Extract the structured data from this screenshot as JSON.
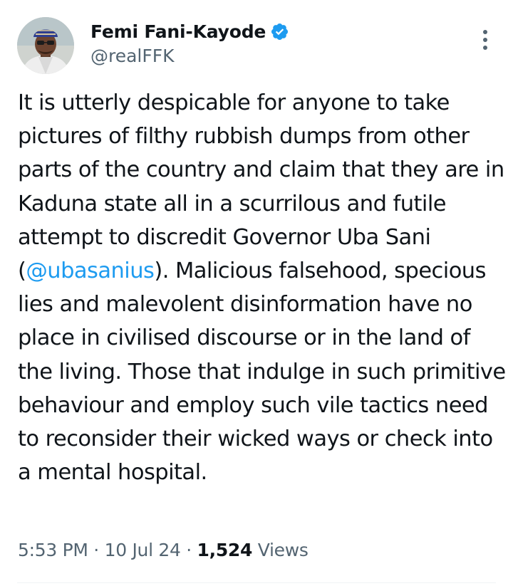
{
  "author": {
    "display_name": "Femi Fani-Kayode",
    "handle": "@realFFK",
    "verified": true,
    "avatar_icon": "profile-photo"
  },
  "tweet": {
    "text_part1": "It is utterly despicable for anyone to take pictures of filthy rubbish dumps from other parts of the country and claim that they are in Kaduna state all in a scurrilous and futile attempt to discredit Governor Uba Sani (",
    "mention": "@ubasanius",
    "text_part2": "). Malicious falsehood, specious lies and malevolent disinformation have no place in civilised discourse or in the land of the living. Those that indulge in such primitive behaviour and employ such vile tactics need to reconsider their wicked ways or check into a mental hospital."
  },
  "meta": {
    "time": "5:53 PM",
    "separator1": " · ",
    "date": "10 Jul 24",
    "separator2": " · ",
    "views_count": "1,524",
    "views_label": " Views"
  },
  "colors": {
    "text": "#0f1419",
    "secondary": "#536471",
    "link": "#1d9bf0",
    "verified_badge": "#1d9bf0",
    "divider": "#eff3f4"
  },
  "icons": {
    "verified": "verified-badge-icon",
    "more": "more-options-icon"
  }
}
